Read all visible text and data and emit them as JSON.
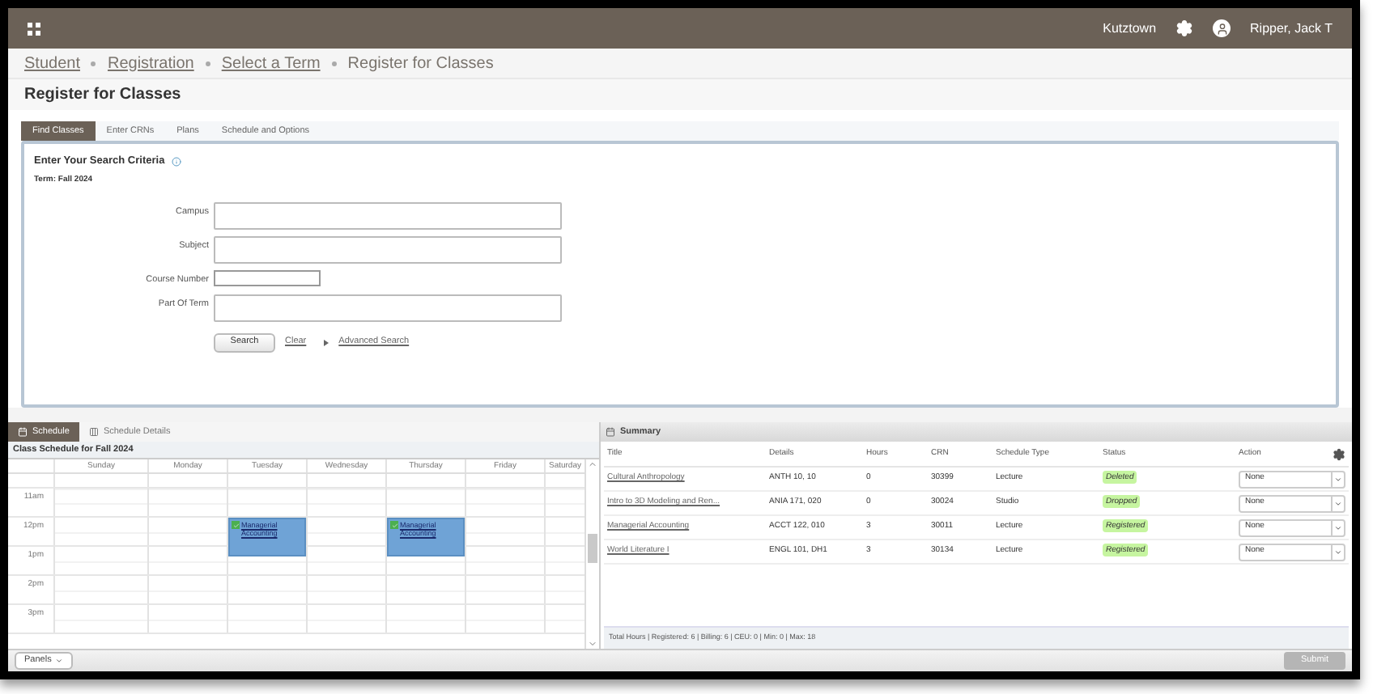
{
  "topbar": {
    "institution": "Kutztown",
    "user": "Ripper, Jack T"
  },
  "breadcrumb": [
    {
      "label": "Student",
      "link": true
    },
    {
      "label": "Registration",
      "link": true
    },
    {
      "label": "Select a Term",
      "link": true
    },
    {
      "label": "Register for Classes",
      "link": false
    }
  ],
  "page_title": "Register for Classes",
  "tabs": [
    {
      "label": "Find Classes",
      "selected": true
    },
    {
      "label": "Enter CRNs",
      "selected": false
    },
    {
      "label": "Plans",
      "selected": false
    },
    {
      "label": "Schedule and Options",
      "selected": false
    }
  ],
  "search": {
    "heading": "Enter Your Search Criteria",
    "term": "Term: Fall 2024",
    "fields": [
      {
        "label": "Campus",
        "kind": "wide"
      },
      {
        "label": "Subject",
        "kind": "wide"
      },
      {
        "label": "Course Number",
        "kind": "short"
      },
      {
        "label": "Part Of Term",
        "kind": "wide"
      }
    ],
    "search_button": "Search",
    "clear_link": "Clear",
    "advanced_link": "Advanced Search"
  },
  "schedule": {
    "tabs": [
      {
        "label": "Schedule",
        "selected": true
      },
      {
        "label": "Schedule Details",
        "selected": false
      }
    ],
    "title": "Class Schedule for Fall 2024",
    "days": [
      "Sunday",
      "Monday",
      "Tuesday",
      "Wednesday",
      "Thursday",
      "Friday",
      "Saturday"
    ],
    "rows": [
      {},
      {
        "label": "11am"
      },
      {
        "label": "12pm",
        "cells": [
          {
            "kind": "empty"
          },
          {
            "kind": "empty"
          },
          {
            "kind": "event",
            "title": "Managerial Accounting",
            "checked": true
          },
          {
            "kind": "empty"
          },
          {
            "kind": "event",
            "title": "Managerial Accounting",
            "checked": true
          },
          {
            "kind": "empty"
          },
          {
            "kind": "empty"
          }
        ]
      },
      {
        "label": "1pm"
      },
      {
        "label": "2pm"
      },
      {
        "label": "3pm"
      }
    ]
  },
  "panels_button": "Panels",
  "summary": {
    "title": "Summary",
    "columns": [
      "Title",
      "Details",
      "Hours",
      "CRN",
      "Schedule Type",
      "Status",
      "Action"
    ],
    "rows": [
      {
        "title": "Cultural Anthropology",
        "details": "ANTH 10, 10",
        "hours": "0",
        "crn": "30399",
        "schedule_type": "Lecture",
        "status": "Deleted",
        "action": "None"
      },
      {
        "title": "Intro to 3D Modeling and Ren...",
        "details": "ANIA 171, 020",
        "hours": "0",
        "crn": "30024",
        "schedule_type": "Studio",
        "status": "Dropped",
        "action": "None"
      },
      {
        "title": "Managerial Accounting",
        "details": "ACCT 122, 010",
        "hours": "3",
        "crn": "30011",
        "schedule_type": "Lecture",
        "status": "Registered",
        "action": "None"
      },
      {
        "title": "World Literature I",
        "details": "ENGL 101, DH1",
        "hours": "3",
        "crn": "30134",
        "schedule_type": "Lecture",
        "status": "Registered",
        "action": "None"
      }
    ],
    "footer": "Total Hours | Registered: 6 | Billing: 6 | CEU: 0 | Min: 0 | Max: 18"
  },
  "submit": {
    "label": "Submit",
    "disabled": true
  }
}
